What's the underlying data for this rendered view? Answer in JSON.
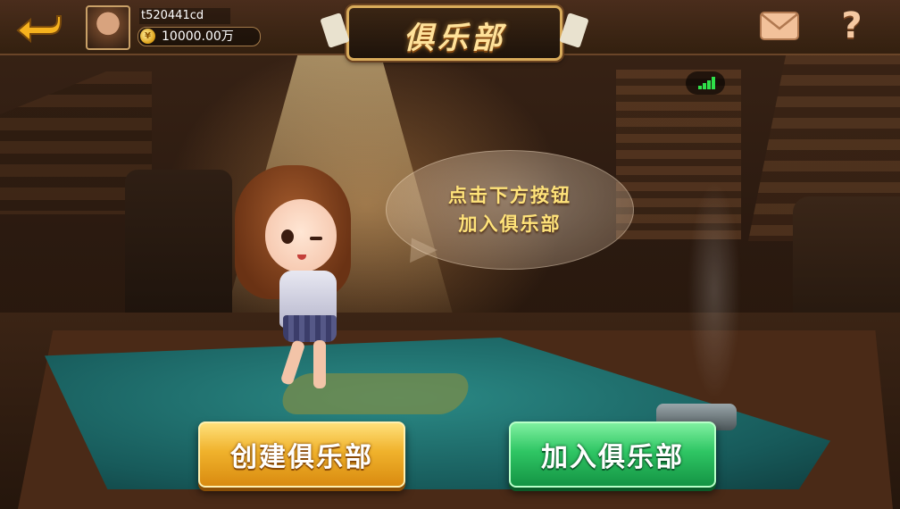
{
  "header": {
    "title": "俱乐部",
    "username": "t520441cd",
    "coins": "10000.00万",
    "coin_icon": "coin-icon",
    "back_icon": "back-arrow-icon",
    "mail_icon": "mail-icon",
    "help_label": "?"
  },
  "bubble": {
    "line1": "点击下方按钮",
    "line2": "加入俱乐部"
  },
  "buttons": {
    "create": "创建俱乐部",
    "join": "加入俱乐部"
  },
  "signal": {
    "icon": "signal-strength-icon",
    "bars": 4
  },
  "colors": {
    "accent_gold": "#f0b22c",
    "accent_green": "#2fc664",
    "signal_green": "#2fe04a"
  }
}
